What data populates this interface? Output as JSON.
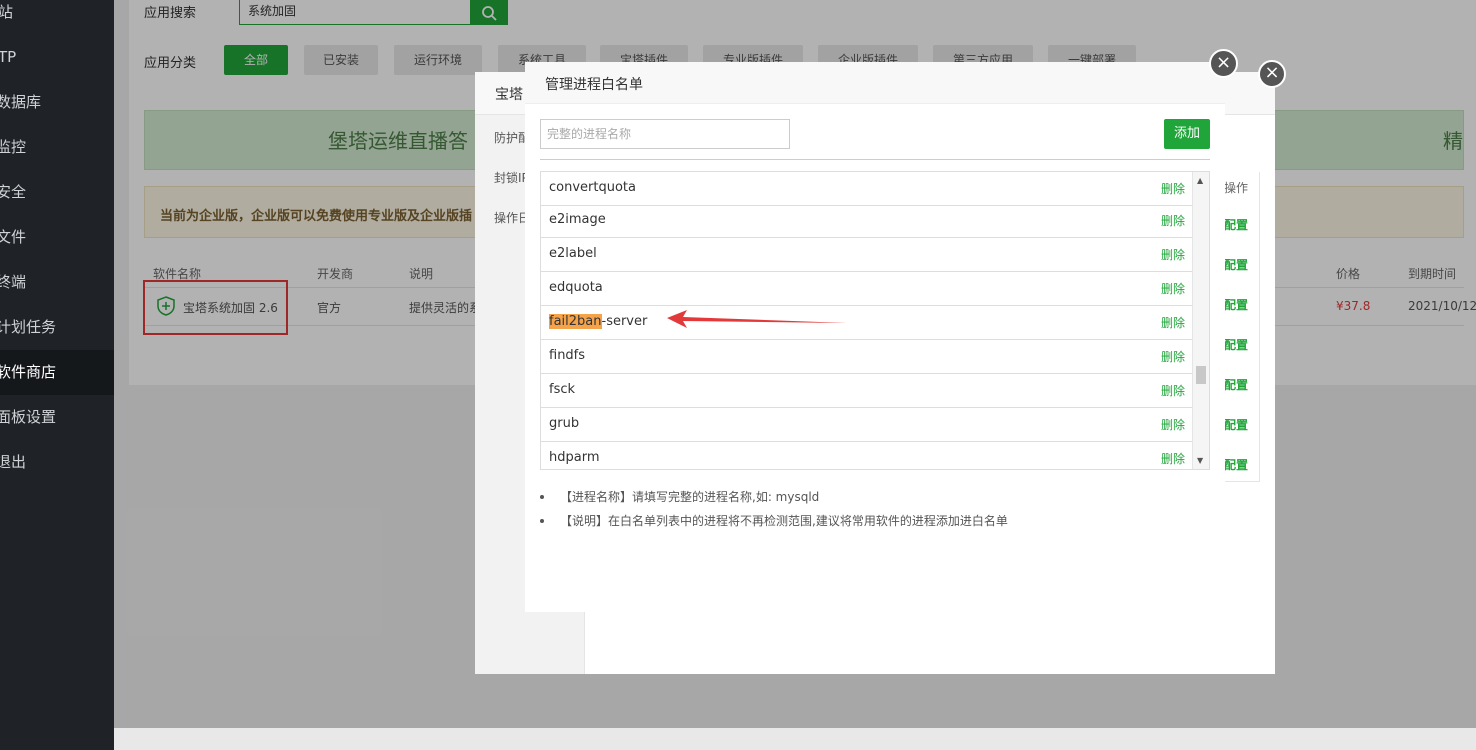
{
  "sidebar": {
    "items": [
      {
        "label": "站"
      },
      {
        "label": "TP"
      },
      {
        "label": "数据库"
      },
      {
        "label": "监控"
      },
      {
        "label": "安全"
      },
      {
        "label": "文件"
      },
      {
        "label": "终端"
      },
      {
        "label": "计划任务"
      },
      {
        "label": "软件商店"
      },
      {
        "label": "面板设置"
      },
      {
        "label": "退出"
      }
    ]
  },
  "store": {
    "search_label": "应用搜索",
    "search_value": "系统加固",
    "category_label": "应用分类",
    "categories": [
      "全部",
      "已安装",
      "运行环境",
      "系统工具",
      "宝塔插件",
      "专业版插件",
      "企业版插件",
      "第三方应用",
      "一键部署"
    ],
    "banner_text": "堡塔运维直播答",
    "banner_right": "精",
    "notice_text": "当前为企业版，企业版可以免费使用专业版及企业版插",
    "table_headers": {
      "name": "软件名称",
      "developer": "开发商",
      "desc": "说明",
      "price": "价格",
      "expire": "到期时间"
    },
    "row": {
      "name": "宝塔系统加固 2.6",
      "developer": "官方",
      "desc": "提供灵活的系",
      "price": "¥37.8",
      "expire": "2021/10/12"
    }
  },
  "bg_dialog": {
    "title": "宝塔",
    "tabs": [
      "防护配",
      "封锁IP",
      "操作日"
    ],
    "op_header": "操作",
    "op_label": "配置"
  },
  "dialog": {
    "title": "管理进程白名单",
    "input_placeholder": "完整的进程名称",
    "add_label": "添加",
    "delete_label": "删除",
    "processes": [
      {
        "highlight": "",
        "name": "convertquota"
      },
      {
        "highlight": "",
        "name": "e2image"
      },
      {
        "highlight": "",
        "name": "e2label"
      },
      {
        "highlight": "",
        "name": "edquota"
      },
      {
        "highlight": "fail2ban",
        "name": "-server"
      },
      {
        "highlight": "",
        "name": "findfs"
      },
      {
        "highlight": "",
        "name": "fsck"
      },
      {
        "highlight": "",
        "name": "grub"
      },
      {
        "highlight": "",
        "name": "hdparm"
      }
    ],
    "tips": [
      "【进程名称】请填写完整的进程名称,如: mysqld",
      "【说明】在白名单列表中的进程将不再检测范围,建议将常用软件的进程添加进白名单"
    ]
  },
  "colors": {
    "accent": "#20a53a",
    "highlight": "#f5a34a",
    "alert": "#e23a3a"
  }
}
